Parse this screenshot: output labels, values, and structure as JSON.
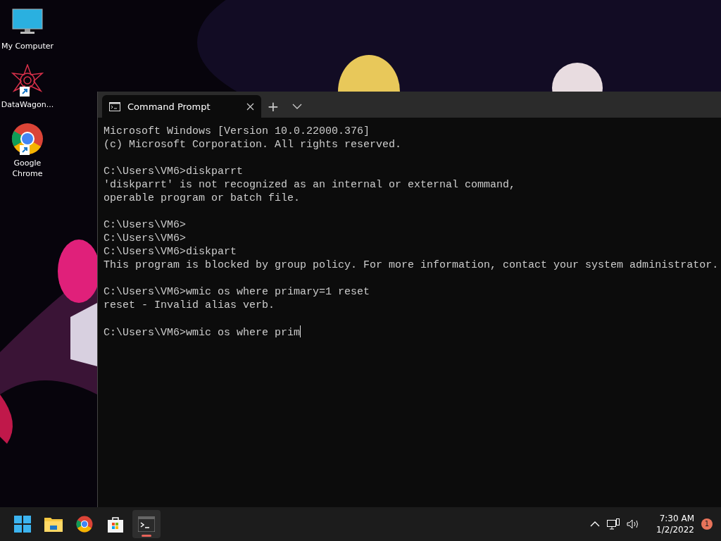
{
  "desktop_icons": [
    {
      "kind": "computer",
      "label": "My Computer",
      "shortcut": false
    },
    {
      "kind": "star",
      "label": "DataWagon...",
      "shortcut": true
    },
    {
      "kind": "chrome",
      "label": "Google Chrome",
      "shortcut": true
    }
  ],
  "window": {
    "tabs": [
      {
        "label": "Command Prompt",
        "selected": true
      }
    ],
    "new_tab": "+"
  },
  "terminal": {
    "blocks": [
      [
        "Microsoft Windows [Version 10.0.22000.376]",
        "(c) Microsoft Corporation. All rights reserved."
      ],
      [
        "C:\\Users\\VM6>diskparrt",
        "'diskparrt' is not recognized as an internal or external command,",
        "operable program or batch file."
      ],
      [
        "C:\\Users\\VM6>",
        "C:\\Users\\VM6>",
        "C:\\Users\\VM6>diskpart",
        "This program is blocked by group policy. For more information, contact your system administrator."
      ],
      [
        "C:\\Users\\VM6>wmic os where primary=1 reset",
        "reset - Invalid alias verb."
      ],
      [
        "C:\\Users\\VM6>wmic os where prim"
      ]
    ],
    "cursor": true
  },
  "taskbar": {
    "apps": [
      {
        "kind": "start",
        "active": false
      },
      {
        "kind": "folder",
        "active": false
      },
      {
        "kind": "chrome",
        "active": false
      },
      {
        "kind": "store",
        "active": false
      },
      {
        "kind": "terminal",
        "active": true
      }
    ],
    "time": "7:30 AM",
    "date": "1/2/2022",
    "notifications": "1"
  }
}
